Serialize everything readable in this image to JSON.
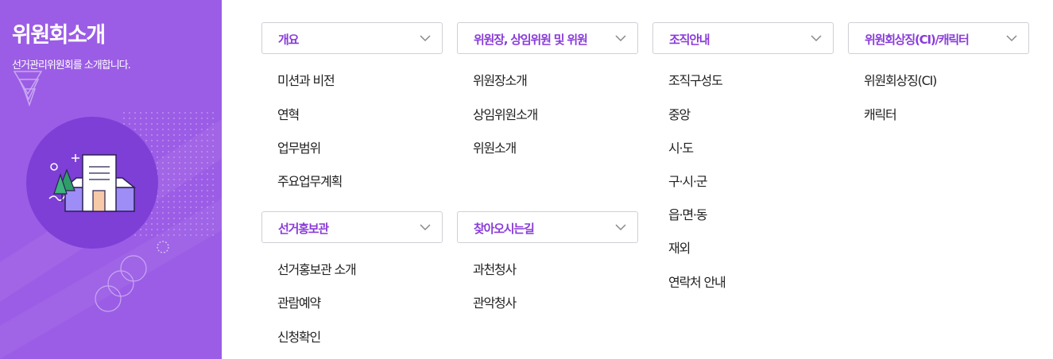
{
  "sidebar": {
    "title": "위원회소개",
    "description": "선거관리위원회를 소개합니다."
  },
  "colors": {
    "sidebar_bg": "#9b5de5",
    "accent": "#8a3cd9",
    "link_text": "#222222",
    "dropdown_border": "#cfcfd6"
  },
  "menus": [
    {
      "label": "개요",
      "icon": "chevron-down-icon",
      "items": [
        "미션과 비전",
        "연혁",
        "업무범위",
        "주요업무계획"
      ]
    },
    {
      "label": "위원장, 상임위원 및 위원",
      "icon": "chevron-down-icon",
      "items": [
        "위원장소개",
        "상임위원소개",
        "위원소개"
      ]
    },
    {
      "label": "조직안내",
      "icon": "chevron-down-icon",
      "items": [
        "조직구성도",
        "중앙",
        "시·도",
        "구·시·군",
        "읍·면·동",
        "재외",
        "연락처 안내"
      ]
    },
    {
      "label": "위원회상징(CI)/캐릭터",
      "icon": "chevron-down-icon",
      "items": [
        "위원회상징(CI)",
        "캐릭터"
      ]
    },
    {
      "label": "선거홍보관",
      "icon": "chevron-down-icon",
      "items": [
        "선거홍보관 소개",
        "관람예약",
        "신청확인"
      ]
    },
    {
      "label": "찾아오시는길",
      "icon": "chevron-down-icon",
      "items": [
        "과천청사",
        "관악청사"
      ]
    }
  ]
}
